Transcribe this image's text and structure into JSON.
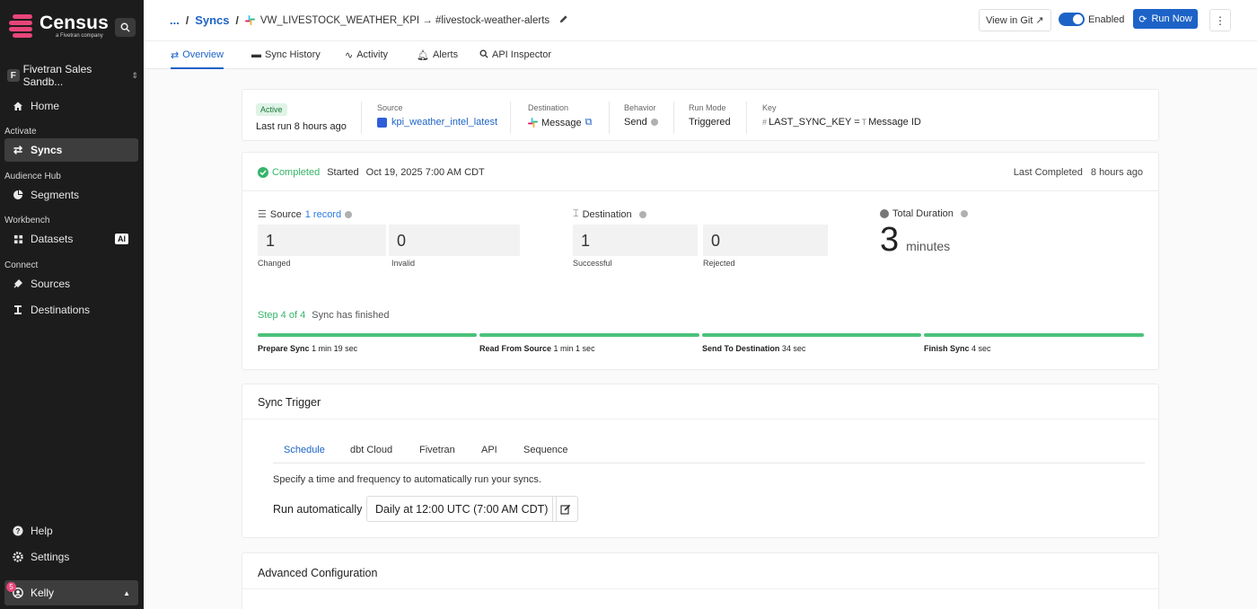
{
  "brand": {
    "name": "Census",
    "sub": "a Fivetran company"
  },
  "workspace": {
    "badge": "F",
    "name": "Fivetran Sales Sandb..."
  },
  "sidebar": {
    "home": "Home",
    "section_activate": "Activate",
    "syncs": "Syncs",
    "section_audience": "Audience Hub",
    "segments": "Segments",
    "section_workbench": "Workbench",
    "datasets": "Datasets",
    "ai_badge": "AI",
    "section_connect": "Connect",
    "sources": "Sources",
    "destinations": "Destinations",
    "help": "Help",
    "settings": "Settings",
    "user_name": "Kelly",
    "user_badge": "5"
  },
  "header": {
    "ellipsis": "...",
    "sep": "/",
    "crumb_syncs": "Syncs",
    "title": "VW_LIVESTOCK_WEATHER_KPI → #livestock-weather-alerts",
    "view_git": "View in Git ↗",
    "enabled": "Enabled",
    "run_now": "Run Now",
    "more": "⋮"
  },
  "tabs": [
    "Overview",
    "Sync History",
    "Activity",
    "Alerts",
    "API Inspector"
  ],
  "summary": {
    "status": "Active",
    "last_run": "Last run 8 hours ago",
    "source_label": "Source",
    "source_value": "kpi_weather_intel_latest",
    "destination_label": "Destination",
    "destination_value": "Message",
    "behavior_label": "Behavior",
    "behavior_value": "Send",
    "run_mode_label": "Run Mode",
    "run_mode_value": "Triggered",
    "key_label": "Key",
    "key_value": "LAST_SYNC_KEY =",
    "key_target": "Message ID"
  },
  "run": {
    "status": "Completed",
    "started_label": "Started",
    "started_value": "Oct 19, 2025 7:00 AM CDT",
    "last_completed_label": "Last Completed",
    "last_completed_value": "8 hours ago",
    "source_label": "Source",
    "source_records": "1 record",
    "changed": "1",
    "changed_label": "Changed",
    "invalid": "0",
    "invalid_label": "Invalid",
    "destination_label": "Destination",
    "successful": "1",
    "successful_label": "Successful",
    "rejected": "0",
    "rejected_label": "Rejected",
    "duration_label": "Total Duration",
    "duration_value": "3",
    "duration_unit": "minutes",
    "step_label": "Step 4 of 4",
    "step_status": "Sync has finished",
    "steps": [
      {
        "name": "Prepare Sync",
        "time": "1 min 19 sec"
      },
      {
        "name": "Read From Source",
        "time": "1 min 1 sec"
      },
      {
        "name": "Send To Destination",
        "time": "34 sec"
      },
      {
        "name": "Finish Sync",
        "time": "4 sec"
      }
    ]
  },
  "trigger": {
    "title": "Sync Trigger",
    "tabs": [
      "Schedule",
      "dbt Cloud",
      "Fivetran",
      "API",
      "Sequence"
    ],
    "description": "Specify a time and frequency to automatically run your syncs.",
    "run_auto_label": "Run automatically",
    "schedule_value": "Daily at 12:00 UTC (7:00 AM CDT)"
  },
  "advanced": {
    "title": "Advanced Configuration"
  }
}
